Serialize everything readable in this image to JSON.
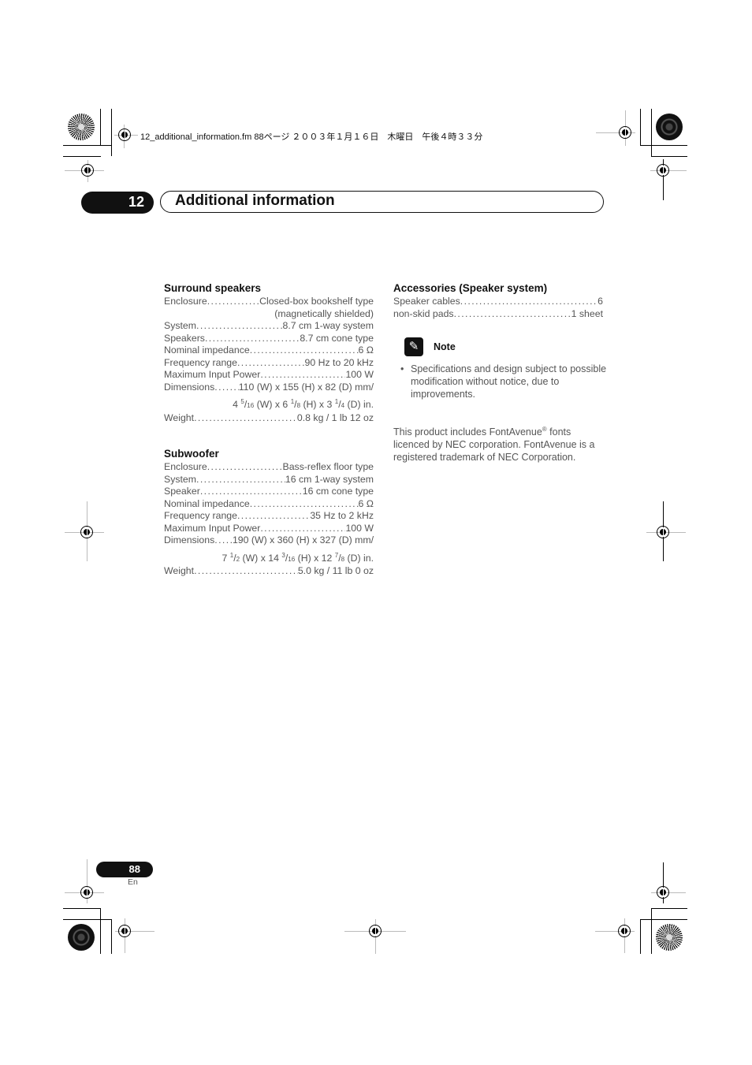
{
  "print_header": {
    "filename": "12_additional_information.fm",
    "page": "88",
    "page_label": "ページ",
    "date": "２００３年１月１６日　木曜日　午後４時３３分"
  },
  "chapter": {
    "number": "12",
    "title": "Additional information"
  },
  "surround_speakers": {
    "heading": "Surround speakers",
    "specs": [
      {
        "label": "Enclosure",
        "value": "Closed-box bookshelf type",
        "continuation": "(magnetically shielded)"
      },
      {
        "label": "System",
        "value": "8.7 cm 1-way system"
      },
      {
        "label": "Speakers",
        "value": "8.7 cm cone type"
      },
      {
        "label": "Nominal impedance",
        "value": "6 Ω"
      },
      {
        "label": "Frequency range",
        "value": "90 Hz to 20 kHz"
      },
      {
        "label": "Maximum Input Power",
        "value": "100 W"
      },
      {
        "label": "Dimensions",
        "value": "110 (W) x 155 (H) x 82 (D) mm/"
      },
      {
        "label": "Weight",
        "value": "0.8 kg / 1 lb 12 oz"
      }
    ],
    "dimensions_in": {
      "w_whole": "4",
      "w_num": "5",
      "w_den": "16",
      "h_whole": "6",
      "h_num": "1",
      "h_den": "8",
      "d_whole": "3",
      "d_num": "1",
      "d_den": "4"
    }
  },
  "subwoofer": {
    "heading": "Subwoofer",
    "specs": [
      {
        "label": "Enclosure",
        "value": "Bass-reflex floor type"
      },
      {
        "label": "System",
        "value": "16 cm 1-way system"
      },
      {
        "label": "Speaker",
        "value": "16 cm cone type"
      },
      {
        "label": "Nominal impedance",
        "value": "6 Ω"
      },
      {
        "label": "Frequency range",
        "value": "35 Hz to 2 kHz"
      },
      {
        "label": "Maximum Input Power",
        "value": "100 W"
      },
      {
        "label": "Dimensions",
        "value": "190 (W) x 360 (H) x 327 (D) mm/"
      },
      {
        "label": "Weight",
        "value": "5.0 kg / 11 lb 0 oz"
      }
    ],
    "dimensions_in": {
      "w_whole": "7",
      "w_num": "1",
      "w_den": "2",
      "h_whole": "14",
      "h_num": "3",
      "h_den": "16",
      "d_whole": "12",
      "d_num": "7",
      "d_den": "8"
    }
  },
  "accessories": {
    "heading": "Accessories (Speaker system)",
    "items": [
      {
        "label": "Speaker cables",
        "value": "6"
      },
      {
        "label": "non-skid pads",
        "value": "1 sheet"
      }
    ]
  },
  "note": {
    "icon": "pencil-icon",
    "label": "Note",
    "bullet": "•",
    "text": "Specifications and design subject to possible modification without notice, due to improvements."
  },
  "credit": {
    "text_before": "This product includes FontAvenue",
    "reg_mark": "®",
    "text_after": " fonts licenced by NEC corporation. FontAvenue is a registered trademark of NEC Corporation."
  },
  "footer": {
    "page_number": "88",
    "language": "En"
  },
  "dim_labels": {
    "w": "(W) x",
    "h": "(H) x",
    "d": "(D) in."
  }
}
